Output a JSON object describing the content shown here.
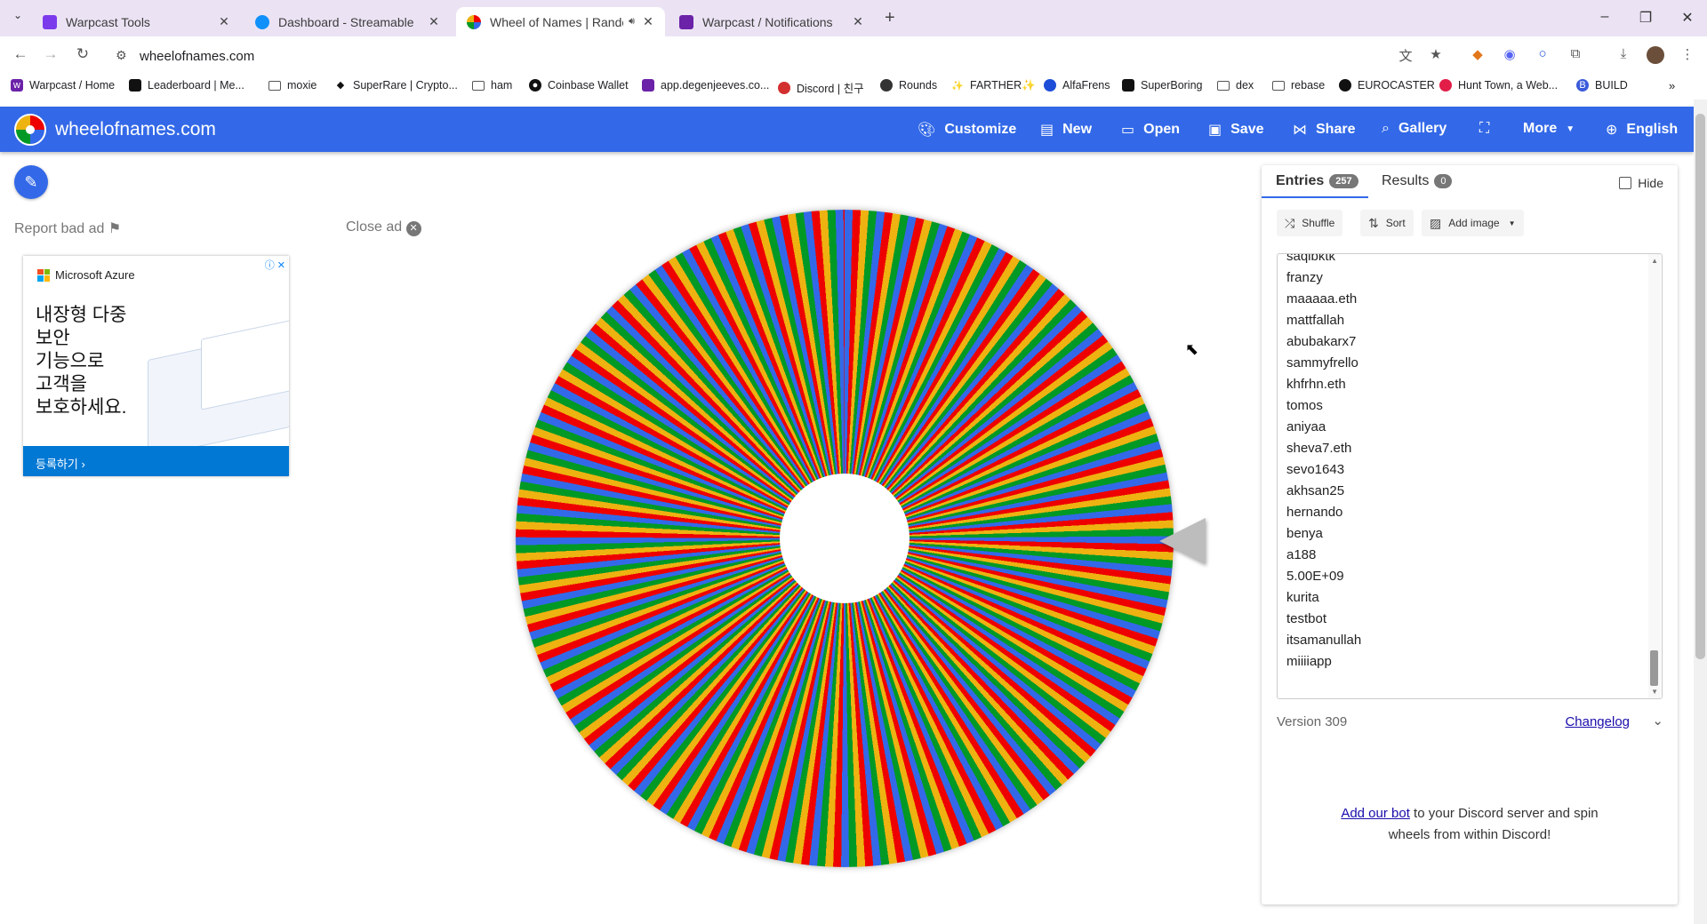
{
  "browser": {
    "tabs": [
      {
        "title": "Warpcast Tools",
        "favicon_color": "#7c3aed"
      },
      {
        "title": "Dashboard - Streamable",
        "favicon_color": "#0f90fa"
      },
      {
        "title": "Wheel of Names | Random",
        "favicon_color": "#3369e8"
      },
      {
        "title": "Warpcast / Notifications",
        "favicon_color": "#6b21a8"
      }
    ],
    "url": "wheelofnames.com",
    "bookmarks": [
      {
        "label": "Warpcast / Home",
        "icon": "warpcast-icon",
        "color": "#6b21a8"
      },
      {
        "label": "Leaderboard | Me...",
        "icon": "leaderboard-icon",
        "color": "#111111"
      },
      {
        "label": "moxie",
        "icon": "folder-icon"
      },
      {
        "label": "SuperRare | Crypto...",
        "icon": "superrare-icon",
        "color": "#111111"
      },
      {
        "label": "ham",
        "icon": "folder-icon"
      },
      {
        "label": "Coinbase Wallet",
        "icon": "coinbase-icon",
        "color": "#111111"
      },
      {
        "label": "app.degenjeeves.co...",
        "icon": "degen-icon",
        "color": "#6b21a8"
      },
      {
        "label": "Discord | 친구",
        "icon": "discord-icon",
        "color": "#d32f2f"
      },
      {
        "label": "Rounds",
        "icon": "rounds-icon",
        "color": "#333333"
      },
      {
        "label": "FARTHER✨",
        "icon": "farther-icon",
        "color": "#eeb211"
      },
      {
        "label": "AlfaFrens",
        "icon": "alfafrens-icon",
        "color": "#1d4ed8"
      },
      {
        "label": "SuperBoring",
        "icon": "superboring-icon",
        "color": "#111111"
      },
      {
        "label": "dex",
        "icon": "folder-icon"
      },
      {
        "label": "rebase",
        "icon": "folder-icon"
      },
      {
        "label": "EUROCASTER",
        "icon": "eurocaster-icon",
        "color": "#111111"
      },
      {
        "label": "Hunt Town, a Web...",
        "icon": "hunttown-icon",
        "color": "#e11d48"
      },
      {
        "label": "BUILD",
        "icon": "build-icon",
        "color": "#3b5bdb"
      }
    ]
  },
  "app": {
    "brand": "wheelofnames.com",
    "menu": [
      {
        "label": "Customize",
        "icon": "palette-icon"
      },
      {
        "label": "New",
        "icon": "file-icon"
      },
      {
        "label": "Open",
        "icon": "folder-open-icon"
      },
      {
        "label": "Save",
        "icon": "save-icon"
      },
      {
        "label": "Share",
        "icon": "share-icon"
      },
      {
        "label": "Gallery",
        "icon": "search-icon"
      },
      {
        "label": "",
        "icon": "fullscreen-icon"
      },
      {
        "label": "More",
        "icon": "chevron-down-icon"
      },
      {
        "label": "English",
        "icon": "globe-icon"
      }
    ],
    "colors": {
      "primary": "#3369e8",
      "red": "#ee0000",
      "yellow": "#eeb211",
      "green": "#009925"
    }
  },
  "ad": {
    "report": "Report bad ad",
    "close": "Close ad",
    "advertiser": "Microsoft Azure",
    "headline_lines": [
      "내장형 다중",
      "보안",
      "기능으로",
      "고객을",
      "보호하세요."
    ],
    "cta": "등록하기 ›"
  },
  "panel": {
    "tab_entries": "Entries",
    "entries_count": "257",
    "tab_results": "Results",
    "results_count": "0",
    "hide_label": "Hide",
    "tools": {
      "shuffle": "Shuffle",
      "sort": "Sort",
      "add_image": "Add image"
    },
    "entries": [
      "saqibktk",
      "franzy",
      "maaaaa.eth",
      "mattfallah",
      "abubakarx7",
      "sammyfrello",
      "khfrhn.eth",
      "tomos",
      "aniyaa",
      "sheva7.eth",
      "sevo1643",
      "akhsan25",
      "hernando",
      "benya",
      "a188",
      "5.00E+09",
      "kurita",
      "testbot",
      "itsamanullah",
      "miiiiapp"
    ],
    "version": "Version 309",
    "changelog": "Changelog",
    "discord_link": "Add our bot",
    "discord_text1": " to your Discord server and spin",
    "discord_text2": "wheels from within Discord!"
  }
}
